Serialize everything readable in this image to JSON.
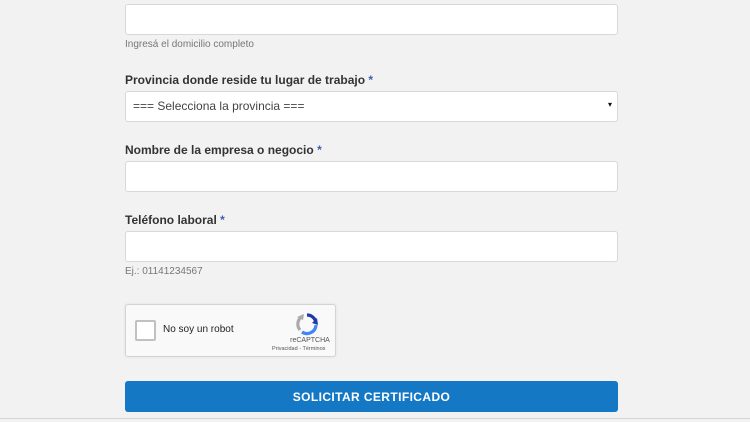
{
  "address": {
    "value": "",
    "help": "Ingresá el domicilio completo"
  },
  "province": {
    "label": "Provincia donde reside tu lugar de trabajo",
    "required_mark": "*",
    "selected": "=== Selecciona la provincia ===",
    "caret_icon": "▾"
  },
  "company": {
    "label": "Nombre de la empresa o negocio",
    "required_mark": "*",
    "value": ""
  },
  "phone": {
    "label": "Teléfono laboral",
    "required_mark": "*",
    "value": "",
    "help": "Ej.: 01141234567"
  },
  "captcha": {
    "label": "No soy un robot",
    "brand": "reCAPTCHA",
    "privacy": "Privacidad",
    "separator": " - ",
    "terms": "Términos"
  },
  "submit": {
    "label": "SOLICITAR CERTIFICADO"
  },
  "colors": {
    "accent": "#1478c5",
    "required": "#3f5fae",
    "background": "#f2f2f2"
  }
}
